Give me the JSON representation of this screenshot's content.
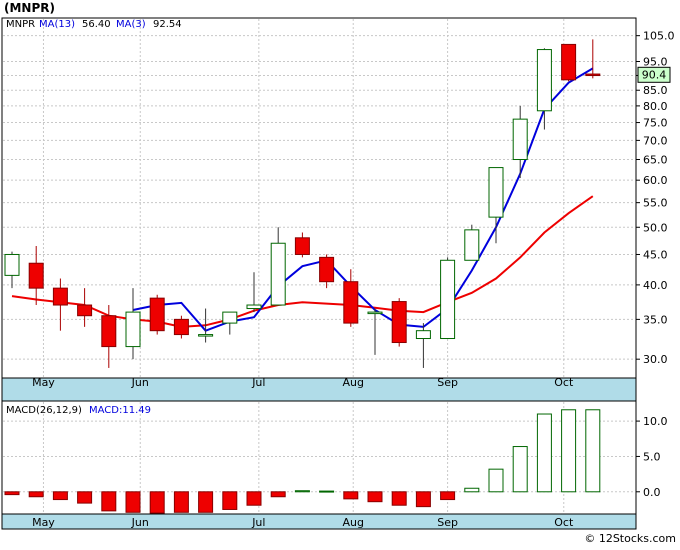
{
  "title": "(MNPR)",
  "watermark": "© 12Stocks.com",
  "colors": {
    "up": "#006600",
    "down": "#ee0000",
    "ma_fast": "#0000dd",
    "ma_slow": "#ee0000",
    "grid": "#c8c8c8",
    "axis_band": "#b0dce8",
    "price_box": "#ccffcc"
  },
  "chart_data": [
    {
      "type": "candlestick",
      "legend": {
        "symbol": "MNPR",
        "ma13_label": "MA(13)",
        "ma13_value": "56.40",
        "ma3_label": "MA(3)",
        "ma3_value": "92.54"
      },
      "last_price": "90.4",
      "y_scale": "log",
      "ylim": [
        28,
        112
      ],
      "yticks": [
        30,
        35,
        40,
        45,
        50,
        55,
        60,
        65,
        70,
        75,
        80,
        85,
        90,
        95,
        105
      ],
      "ytick_labels": [
        "30.0",
        "35.0",
        "40.0",
        "45.0",
        "50.0",
        "55.0",
        "60.0",
        "65.0",
        "70.0",
        "75.0",
        "80.0",
        "85.0",
        "90.0",
        "95.0",
        "105.0"
      ],
      "months": [
        {
          "label": "May",
          "at": 1.3
        },
        {
          "label": "Jun",
          "at": 5.3
        },
        {
          "label": "Jul",
          "at": 10.2
        },
        {
          "label": "Aug",
          "at": 14.1
        },
        {
          "label": "Sep",
          "at": 18.0
        },
        {
          "label": "Oct",
          "at": 22.8
        }
      ],
      "candles": [
        {
          "o": 41.5,
          "h": 45.5,
          "l": 39.5,
          "c": 45.0
        },
        {
          "o": 43.5,
          "h": 46.5,
          "l": 37.0,
          "c": 39.5
        },
        {
          "o": 39.5,
          "h": 41.0,
          "l": 33.5,
          "c": 37.0
        },
        {
          "o": 37.0,
          "h": 39.5,
          "l": 34.0,
          "c": 35.5
        },
        {
          "o": 35.5,
          "h": 37.0,
          "l": 29.0,
          "c": 31.5
        },
        {
          "o": 31.5,
          "h": 39.5,
          "l": 30.0,
          "c": 36.0
        },
        {
          "o": 38.0,
          "h": 38.5,
          "l": 33.0,
          "c": 33.5
        },
        {
          "o": 35.0,
          "h": 35.5,
          "l": 32.5,
          "c": 33.0
        },
        {
          "o": 33.0,
          "h": 36.5,
          "l": 32.0,
          "c": 33.0
        },
        {
          "o": 34.5,
          "h": 36.0,
          "l": 33.0,
          "c": 36.0
        },
        {
          "o": 36.5,
          "h": 42.0,
          "l": 36.0,
          "c": 37.0
        },
        {
          "o": 37.0,
          "h": 50.0,
          "l": 37.0,
          "c": 47.0
        },
        {
          "o": 48.0,
          "h": 49.0,
          "l": 44.5,
          "c": 45.0
        },
        {
          "o": 44.5,
          "h": 45.0,
          "l": 39.5,
          "c": 40.5
        },
        {
          "o": 40.5,
          "h": 42.5,
          "l": 34.0,
          "c": 34.5
        },
        {
          "o": 36.0,
          "h": 36.5,
          "l": 30.5,
          "c": 36.0
        },
        {
          "o": 37.5,
          "h": 38.0,
          "l": 31.5,
          "c": 32.0
        },
        {
          "o": 32.5,
          "h": 34.5,
          "l": 29.0,
          "c": 33.5
        },
        {
          "o": 32.5,
          "h": 44.5,
          "l": 32.5,
          "c": 44.0
        },
        {
          "o": 44.0,
          "h": 50.5,
          "l": 44.0,
          "c": 49.5
        },
        {
          "o": 52.0,
          "h": 63.0,
          "l": 47.0,
          "c": 63.0
        },
        {
          "o": 65.0,
          "h": 80.0,
          "l": 60.5,
          "c": 76.0
        },
        {
          "o": 78.5,
          "h": 100.0,
          "l": 73.0,
          "c": 99.5
        },
        {
          "o": 101.5,
          "h": 101.5,
          "l": 88.0,
          "c": 88.5
        },
        {
          "o": 90.5,
          "h": 103.5,
          "l": 89.0,
          "c": 90.0
        }
      ],
      "ma_fast": [
        null,
        null,
        null,
        null,
        null,
        36.3,
        37.0,
        37.3,
        33.5,
        34.7,
        35.3,
        39.8,
        43.0,
        44.0,
        39.8,
        36.3,
        34.3,
        34.0,
        36.5,
        42.3,
        50.0,
        61.5,
        79.0,
        87.5,
        92.5
      ],
      "ma_slow": [
        38.3,
        37.8,
        37.4,
        37.0,
        35.5,
        35.0,
        34.7,
        34.0,
        34.2,
        35.0,
        36.2,
        37.0,
        37.4,
        37.2,
        37.0,
        36.6,
        36.2,
        36.0,
        37.4,
        38.8,
        41.0,
        44.5,
        49.0,
        52.8,
        56.4
      ]
    },
    {
      "type": "bar",
      "legend": {
        "label": "MACD(26,12,9)",
        "value_label": "MACD:11.49"
      },
      "ylim": [
        -3,
        12.7
      ],
      "yticks": [
        0,
        5,
        10
      ],
      "ytick_labels": [
        "0.0",
        "5.0",
        "10.0"
      ],
      "values": [
        -0.4,
        -0.7,
        -1.1,
        -1.6,
        -2.7,
        -2.9,
        -3.0,
        -2.9,
        -2.9,
        -2.5,
        -1.9,
        -0.7,
        0.15,
        0.1,
        -1.0,
        -1.4,
        -1.9,
        -2.1,
        -1.1,
        0.5,
        3.2,
        6.4,
        11.0,
        11.6,
        11.6
      ]
    }
  ]
}
